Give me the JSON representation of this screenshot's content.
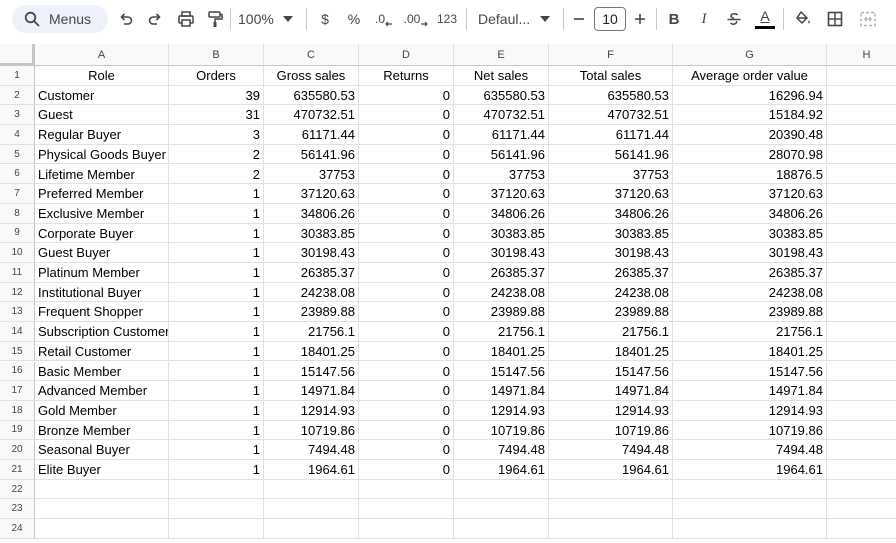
{
  "toolbar": {
    "search_label": "Menus",
    "zoom": "100%",
    "currency": "$",
    "percent": "%",
    "decrease_decimal": ".0",
    "increase_decimal": ".00",
    "number_format": "123",
    "font_family": "Defaul...",
    "font_size": "10",
    "bold": "B",
    "italic": "I",
    "text_color_letter": "A"
  },
  "columns": [
    "A",
    "B",
    "C",
    "D",
    "E",
    "F",
    "G",
    "H"
  ],
  "row_numbers": [
    "1",
    "2",
    "3",
    "4",
    "5",
    "6",
    "7",
    "8",
    "9",
    "10",
    "11",
    "12",
    "13",
    "14",
    "15",
    "16",
    "17",
    "18",
    "19",
    "20",
    "21",
    "22",
    "23",
    "24"
  ],
  "rows": [
    [
      "Role",
      "Orders",
      "Gross sales",
      "Returns",
      "Net sales",
      "Total sales",
      "Average order value"
    ],
    [
      "Customer",
      "39",
      "635580.53",
      "0",
      "635580.53",
      "635580.53",
      "16296.94"
    ],
    [
      "Guest",
      "31",
      "470732.51",
      "0",
      "470732.51",
      "470732.51",
      "15184.92"
    ],
    [
      "Regular Buyer",
      "3",
      "61171.44",
      "0",
      "61171.44",
      "61171.44",
      "20390.48"
    ],
    [
      "Physical Goods Buyer",
      "2",
      "56141.96",
      "0",
      "56141.96",
      "56141.96",
      "28070.98"
    ],
    [
      "Lifetime Member",
      "2",
      "37753",
      "0",
      "37753",
      "37753",
      "18876.5"
    ],
    [
      "Preferred Member",
      "1",
      "37120.63",
      "0",
      "37120.63",
      "37120.63",
      "37120.63"
    ],
    [
      "Exclusive Member",
      "1",
      "34806.26",
      "0",
      "34806.26",
      "34806.26",
      "34806.26"
    ],
    [
      "Corporate Buyer",
      "1",
      "30383.85",
      "0",
      "30383.85",
      "30383.85",
      "30383.85"
    ],
    [
      "Guest Buyer",
      "1",
      "30198.43",
      "0",
      "30198.43",
      "30198.43",
      "30198.43"
    ],
    [
      "Platinum Member",
      "1",
      "26385.37",
      "0",
      "26385.37",
      "26385.37",
      "26385.37"
    ],
    [
      "Institutional Buyer",
      "1",
      "24238.08",
      "0",
      "24238.08",
      "24238.08",
      "24238.08"
    ],
    [
      "Frequent Shopper",
      "1",
      "23989.88",
      "0",
      "23989.88",
      "23989.88",
      "23989.88"
    ],
    [
      "Subscription Customer",
      "1",
      "21756.1",
      "0",
      "21756.1",
      "21756.1",
      "21756.1"
    ],
    [
      "Retail Customer",
      "1",
      "18401.25",
      "0",
      "18401.25",
      "18401.25",
      "18401.25"
    ],
    [
      "Basic Member",
      "1",
      "15147.56",
      "0",
      "15147.56",
      "15147.56",
      "15147.56"
    ],
    [
      "Advanced Member",
      "1",
      "14971.84",
      "0",
      "14971.84",
      "14971.84",
      "14971.84"
    ],
    [
      "Gold Member",
      "1",
      "12914.93",
      "0",
      "12914.93",
      "12914.93",
      "12914.93"
    ],
    [
      "Bronze Member",
      "1",
      "10719.86",
      "0",
      "10719.86",
      "10719.86",
      "10719.86"
    ],
    [
      "Seasonal Buyer",
      "1",
      "7494.48",
      "0",
      "7494.48",
      "7494.48",
      "7494.48"
    ],
    [
      "Elite Buyer",
      "1",
      "1964.61",
      "0",
      "1964.61",
      "1964.61",
      "1964.61"
    ]
  ]
}
